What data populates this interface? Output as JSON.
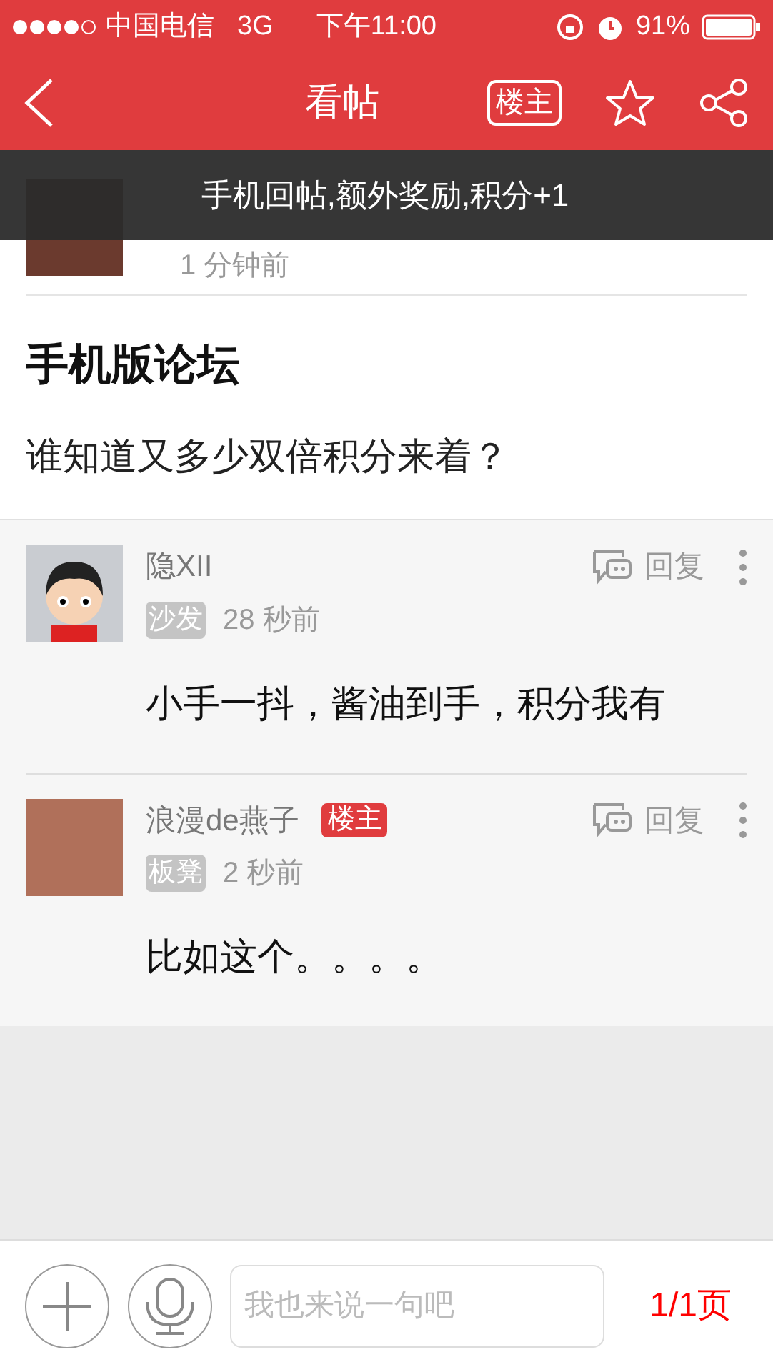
{
  "status_bar": {
    "carrier": "中国电信",
    "network": "3G",
    "time": "下午11:00",
    "battery": "91%"
  },
  "nav": {
    "title": "看帖",
    "op_button": "楼主"
  },
  "toast": "手机回帖,额外奖励,积分+1",
  "post": {
    "time": "1 分钟前",
    "title": "手机版论坛",
    "body": "谁知道又多少双倍积分来着？"
  },
  "replies": [
    {
      "author": "隐XII",
      "kind": "cartoon",
      "badges": [
        {
          "kind": "floor",
          "text": "沙发"
        }
      ],
      "time": "28 秒前",
      "action": "回复",
      "content": "小手一抖，酱油到手，积分我有"
    },
    {
      "author": "浪漫de燕子",
      "kind": "photo",
      "badges": [
        {
          "kind": "op",
          "text": "楼主"
        },
        {
          "kind": "floor",
          "text": "板凳"
        }
      ],
      "time": "2 秒前",
      "action": "回复",
      "content": "比如这个。。。。"
    }
  ],
  "composer": {
    "placeholder": "我也来说一句吧",
    "page": "1/1页"
  }
}
